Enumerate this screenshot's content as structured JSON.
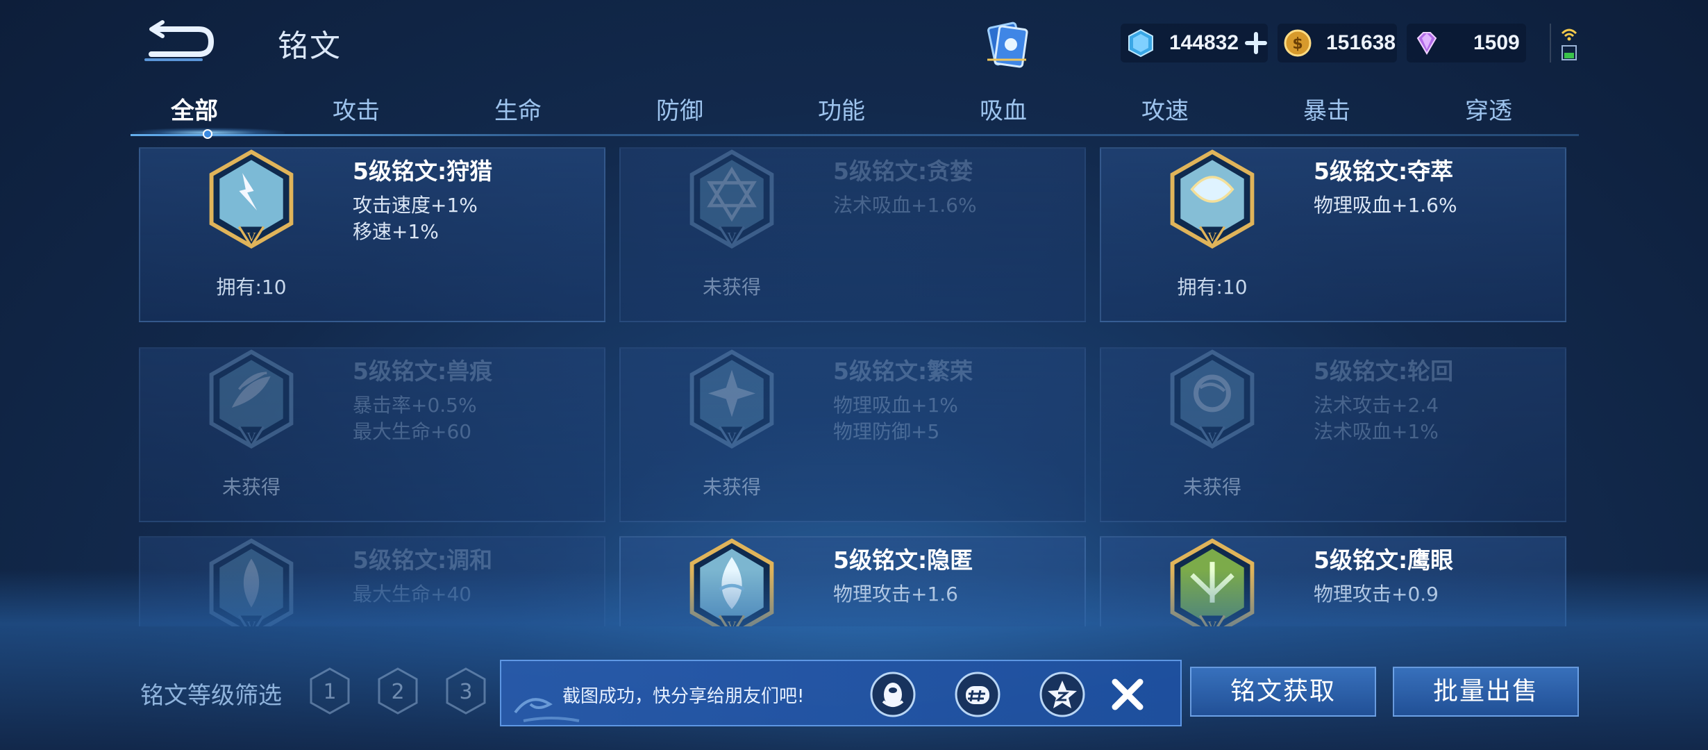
{
  "header": {
    "title": "铭文",
    "currencies": [
      {
        "icon": "gem-icon",
        "value": "144832"
      },
      {
        "icon": "gold-coin-icon",
        "value": "151638"
      },
      {
        "icon": "purple-diamond-icon",
        "value": "1509"
      }
    ]
  },
  "tabs": [
    {
      "label": "全部",
      "active": true
    },
    {
      "label": "攻击"
    },
    {
      "label": "生命"
    },
    {
      "label": "防御"
    },
    {
      "label": "功能"
    },
    {
      "label": "吸血"
    },
    {
      "label": "攻速"
    },
    {
      "label": "暴击"
    },
    {
      "label": "穿透"
    }
  ],
  "runes": [
    {
      "name": "5级铭文:狩猎",
      "stats": [
        "攻击速度+1%",
        "移速+1%"
      ],
      "owned": "拥有:10",
      "locked": false,
      "color": "#8fd3ef"
    },
    {
      "name": "5级铭文:贪婪",
      "stats": [
        "法术吸血+1.6%"
      ],
      "owned": "未获得",
      "locked": true,
      "color": "#6fa9cf"
    },
    {
      "name": "5级铭文:夺萃",
      "stats": [
        "物理吸血+1.6%"
      ],
      "owned": "拥有:10",
      "locked": false,
      "color": "#9ad8ef"
    },
    {
      "name": "5级铭文:兽痕",
      "stats": [
        "暴击率+0.5%",
        "最大生命+60"
      ],
      "owned": "未获得",
      "locked": true,
      "color": "#6fa9cf"
    },
    {
      "name": "5级铭文:繁荣",
      "stats": [
        "物理吸血+1%",
        "物理防御+5"
      ],
      "owned": "未获得",
      "locked": true,
      "color": "#6fa9cf"
    },
    {
      "name": "5级铭文:轮回",
      "stats": [
        "法术攻击+2.4",
        "法术吸血+1%"
      ],
      "owned": "未获得",
      "locked": true,
      "color": "#6fa9cf"
    },
    {
      "name": "5级铭文:调和",
      "stats": [
        "最大生命+40"
      ],
      "owned": "",
      "locked": true,
      "color": "#6fa9cf"
    },
    {
      "name": "5级铭文:隐匿",
      "stats": [
        "物理攻击+1.6"
      ],
      "owned": "",
      "locked": false,
      "color": "#8fcfe8"
    },
    {
      "name": "5级铭文:鹰眼",
      "stats": [
        "物理攻击+0.9"
      ],
      "owned": "",
      "locked": false,
      "color": "#8fc24a"
    }
  ],
  "filter": {
    "label": "铭文等级筛选",
    "levels": [
      "1",
      "2",
      "3"
    ]
  },
  "toast": {
    "message": "截图成功，快分享给朋友们吧!",
    "share_icons": [
      "qq-penguin-icon",
      "wechat-moments-icon",
      "qzone-star-icon"
    ]
  },
  "actions": {
    "acquire": "铭文获取",
    "bulk_sell": "批量出售"
  }
}
